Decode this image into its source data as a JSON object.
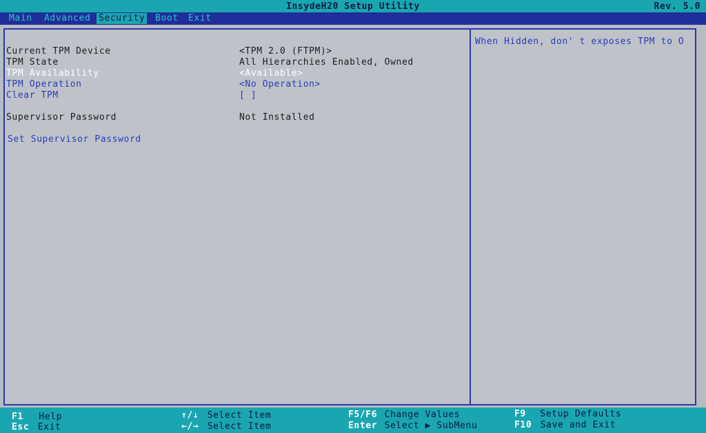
{
  "titlebar": {
    "title": "InsydeH20 Setup Utility",
    "rev": "Rev. 5.0"
  },
  "menu": {
    "tabs": [
      {
        "label": "Main",
        "active": false
      },
      {
        "label": "Advanced",
        "active": false
      },
      {
        "label": "Security",
        "active": true
      },
      {
        "label": "Boot",
        "active": false
      },
      {
        "label": "Exit",
        "active": false
      }
    ]
  },
  "security": {
    "rows": [
      {
        "label": "Current TPM Device",
        "value": "<TPM 2.0 (FTPM)>"
      },
      {
        "label": "TPM State",
        "value": "All Hierarchies Enabled, Owned"
      },
      {
        "label": "TPM Availability",
        "value": "<Available>"
      },
      {
        "label": "TPM Operation",
        "value": "<No Operation>"
      },
      {
        "label": "Clear TPM",
        "value": "[ ]"
      },
      {
        "label": "Supervisor Password",
        "value": "Not Installed"
      },
      {
        "label": "Set Supervisor Password",
        "value": ""
      }
    ]
  },
  "help": {
    "text": "When Hidden, don' t exposes TPM to O"
  },
  "statusbar": {
    "items": [
      {
        "key": "F1",
        "desc": "Help"
      },
      {
        "key": "Esc",
        "desc": "Exit"
      },
      {
        "key": "↑/↓",
        "desc": "Select Item"
      },
      {
        "key": "←/→",
        "desc": "Select Item"
      },
      {
        "key": "F5/F6",
        "desc": "Change Values"
      },
      {
        "key": "Enter",
        "desc": "Select ▶ SubMenu"
      },
      {
        "key": "F9",
        "desc": "Setup Defaults"
      },
      {
        "key": "F10",
        "desc": "Save and Exit"
      }
    ]
  },
  "colors": {
    "title_bar": "#1aa6b0",
    "menu_bar": "#1f2e9a",
    "panel_bg": "#bfc3c9",
    "border": "#2a36a8",
    "selectable_text": "#2a3bb8",
    "highlight_text": "#ffffff"
  }
}
